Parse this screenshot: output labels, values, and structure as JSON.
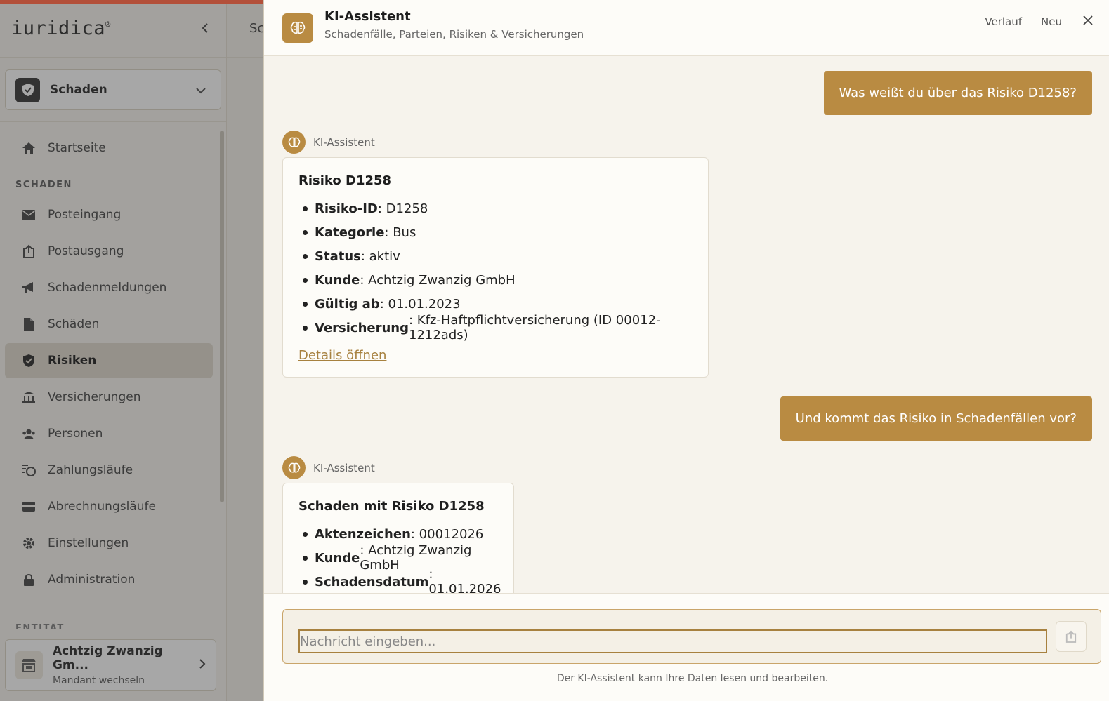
{
  "sidebar": {
    "logo": "iuridica",
    "logo_mark": "®",
    "module": "Schaden",
    "nav": [
      {
        "label": "Startseite",
        "icon": "home-icon"
      },
      {
        "section": "SCHADEN"
      },
      {
        "label": "Posteingang",
        "icon": "mail-icon"
      },
      {
        "label": "Postausgang",
        "icon": "outbox-icon"
      },
      {
        "label": "Schadenmeldungen",
        "icon": "megaphone-icon"
      },
      {
        "label": "Schäden",
        "icon": "file-icon"
      },
      {
        "label": "Risiken",
        "icon": "shield-icon",
        "active": true
      },
      {
        "label": "Versicherungen",
        "icon": "bank-icon"
      },
      {
        "label": "Personen",
        "icon": "users-icon"
      },
      {
        "label": "Zahlungsläufe",
        "icon": "payment-run-icon"
      },
      {
        "label": "Abrechnungsläufe",
        "icon": "card-icon"
      },
      {
        "label": "Einstellungen",
        "icon": "gear-icon"
      },
      {
        "label": "Administration",
        "icon": "lock-icon"
      }
    ],
    "entity_section": "ENTITÄT",
    "tenant": {
      "name": "Achtzig Zwanzig Gm...",
      "sub": "Mandant wechseln"
    }
  },
  "content": {
    "header_fragment": "Sc"
  },
  "assistant": {
    "title": "KI-Assistent",
    "subtitle": "Schadenfälle, Parteien, Risiken & Versicherungen",
    "actions": {
      "history": "Verlauf",
      "new": "Neu"
    },
    "bot_name": "KI-Assistent",
    "messages": {
      "q1": "Was weißt du über das Risiko D1258?",
      "a1": {
        "title": "Risiko D1258",
        "items": [
          {
            "key": "Risiko-ID",
            "value": ": D1258"
          },
          {
            "key": "Kategorie",
            "value": ": Bus"
          },
          {
            "key": "Status",
            "value": ": aktiv"
          },
          {
            "key": "Kunde",
            "value": ": Achtzig Zwanzig GmbH"
          },
          {
            "key": "Gültig ab",
            "value": ": 01.01.2023"
          },
          {
            "key": "Versicherung",
            "value": ": Kfz-Haftpflichtversicherung (ID 00012-1212ads)"
          }
        ],
        "link": "Details öffnen"
      },
      "q2": "Und kommt das Risiko in Schadenfällen vor?",
      "a2": {
        "title": "Schaden mit Risiko D1258",
        "items": [
          {
            "key": "Aktenzeichen",
            "value": ": 00012026"
          },
          {
            "key": "Kunde",
            "value": ": Achtzig Zwanzig GmbH"
          },
          {
            "key": "Schadensdatum",
            "value": ": 01.01.2026"
          }
        ]
      }
    },
    "input_placeholder": "Nachricht eingeben...",
    "disclaimer": "Der KI-Assistent kann Ihre Daten lesen und bearbeiten."
  },
  "colors": {
    "accent": "#b98b42",
    "top_bar": "#b3503a"
  }
}
